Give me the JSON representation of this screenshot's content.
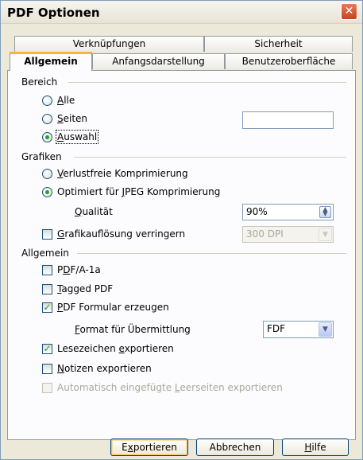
{
  "window": {
    "title": "PDF Optionen"
  },
  "tabs": {
    "row1": [
      "Verknüpfungen",
      "Sicherheit"
    ],
    "row2": [
      "Allgemein",
      "Anfangsdarstellung",
      "Benutzeroberfläche"
    ]
  },
  "bereich": {
    "label": "Bereich",
    "alle_pre": "",
    "alle_acc": "A",
    "alle_post": "lle",
    "seiten_pre": "",
    "seiten_acc": "S",
    "seiten_post": "eiten",
    "seiten_value": "",
    "auswahl_pre": "",
    "auswahl_acc": "A",
    "auswahl_post": "uswahl",
    "selected": "Auswahl"
  },
  "grafiken": {
    "label": "Grafiken",
    "verlust_pre": "",
    "verlust_acc": "V",
    "verlust_post": "erlustfreie Komprimierung",
    "jpeg_pre": "Optimiert für ",
    "jpeg_acc": "J",
    "jpeg_post": "PEG Komprimierung",
    "qualitaet_pre": "",
    "qualitaet_acc": "Q",
    "qualitaet_post": "ualität",
    "qualitaet_value": "90%",
    "reduce_pre": "",
    "reduce_acc": "G",
    "reduce_post": "rafikauflösung verringern",
    "dpi_value": "300 DPI",
    "selected": "Optimiert für JPEG Komprimierung"
  },
  "allgemein": {
    "label": "Allgemein",
    "pdfa_pre": "P",
    "pdfa_acc": "D",
    "pdfa_post": "F/A-1a",
    "tagged_pre": "",
    "tagged_acc": "T",
    "tagged_post": "agged PDF",
    "formular_pre": "",
    "formular_acc": "P",
    "formular_post": "DF Formular erzeugen",
    "format_pre": "",
    "format_acc": "F",
    "format_post": "ormat für Übermittlung",
    "format_value": "FDF",
    "lesezeichen_pre": "Lesezeichen ",
    "lesezeichen_acc": "e",
    "lesezeichen_post": "xportieren",
    "notizen_pre": "",
    "notizen_acc": "N",
    "notizen_post": "otizen exportieren",
    "leerseiten_pre": "Automatisch eingefügte ",
    "leerseiten_acc": "L",
    "leerseiten_post": "eerseiten exportieren"
  },
  "buttons": {
    "export_pre": "E",
    "export_acc": "x",
    "export_post": "portieren",
    "cancel": "Abbrechen",
    "help_pre": "",
    "help_acc": "H",
    "help_post": "ilfe"
  }
}
